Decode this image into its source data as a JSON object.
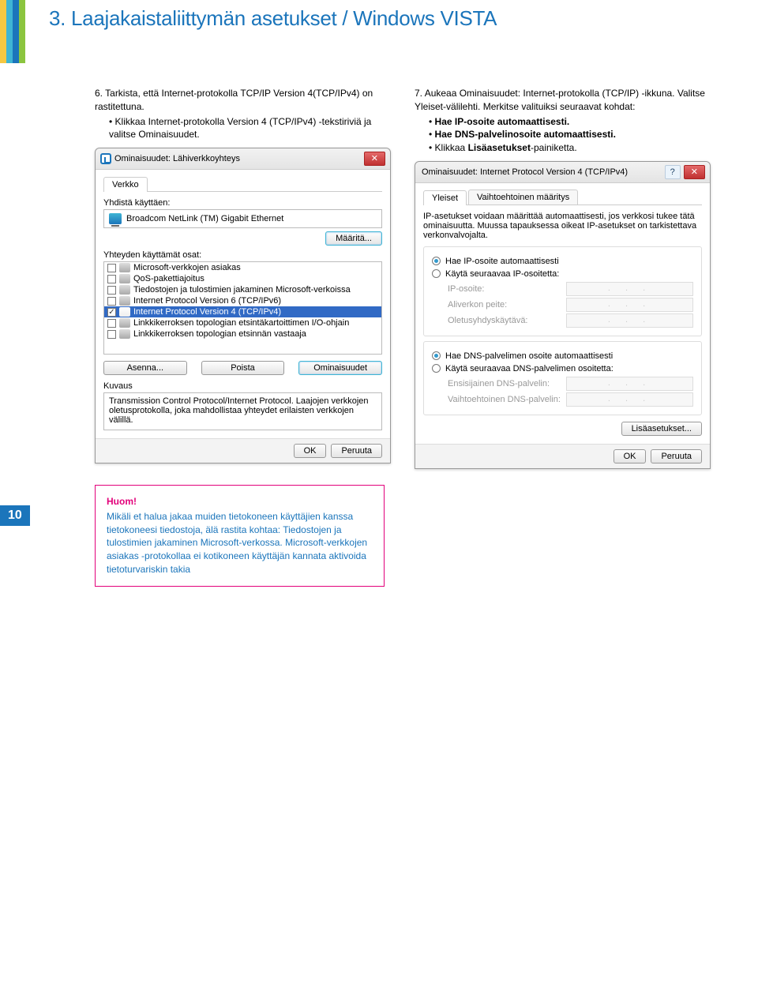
{
  "header": {
    "section_title": "3. Laajakaistaliittymän asetukset / Windows VISTA"
  },
  "instr6": {
    "num": "6.",
    "line1": "Tarkista, että Internet-protokolla TCP/IP Version 4(TCP/IPv4) on rastitettuna.",
    "bullet1": "Klikkaa Internet-protokolla Version 4 (TCP/IPv4) -tekstiriviä ja valitse Ominaisuudet."
  },
  "instr7": {
    "num": "7.",
    "line1": "Aukeaa Ominaisuudet: Internet-protokolla (TCP/IP) -ikkuna. Valitse Yleiset-välilehti. Merkitse valituiksi seuraavat kohdat:",
    "bullet1": "Hae IP-osoite automaattisesti.",
    "bullet2": "Hae DNS-palvelinosoite automaattisesti.",
    "bullet3": "Klikkaa Lisäasetukset-painiketta."
  },
  "dialog1": {
    "title": "Ominaisuudet: Lähiverkkoyhteys",
    "tab_verkko": "Verkko",
    "label_yhdista": "Yhdistä käyttäen:",
    "adapter": "Broadcom NetLink (TM) Gigabit Ethernet",
    "btn_maarita": "Määritä...",
    "label_osat": "Yhteyden käyttämät osat:",
    "items": [
      {
        "checked": false,
        "text": "Microsoft-verkkojen asiakas"
      },
      {
        "checked": false,
        "text": "QoS-pakettiajoitus"
      },
      {
        "checked": false,
        "text": "Tiedostojen ja tulostimien jakaminen Microsoft-verkoissa"
      },
      {
        "checked": false,
        "text": "Internet Protocol Version 6 (TCP/IPv6)"
      },
      {
        "checked": true,
        "highlight": true,
        "text": "Internet Protocol Version 4 (TCP/IPv4)"
      },
      {
        "checked": false,
        "text": "Linkkikerroksen topologian etsintäkartoittimen I/O-ohjain"
      },
      {
        "checked": false,
        "text": "Linkkikerroksen topologian etsinnän vastaaja"
      }
    ],
    "btn_asenna": "Asenna...",
    "btn_poista": "Poista",
    "btn_ominaisuudet": "Ominaisuudet",
    "label_kuvaus": "Kuvaus",
    "kuvaus_text": "Transmission Control Protocol/Internet Protocol. Laajojen verkkojen oletusprotokolla, joka mahdollistaa yhteydet erilaisten verkkojen välillä.",
    "btn_ok": "OK",
    "btn_peruuta": "Peruuta"
  },
  "dialog2": {
    "title": "Ominaisuudet: Internet Protocol Version 4 (TCP/IPv4)",
    "tab_yleiset": "Yleiset",
    "tab_vaihto": "Vaihtoehtoinen määritys",
    "info": "IP-asetukset voidaan määrittää automaattisesti, jos verkkosi tukee tätä ominaisuutta. Muussa tapauksessa oikeat IP-asetukset on tarkistettava verkonvalvojalta.",
    "radio_hae_ip": "Hae IP-osoite automaattisesti",
    "radio_kayta_ip": "Käytä seuraavaa IP-osoitetta:",
    "lbl_iposoite": "IP-osoite:",
    "lbl_aliverkko": "Aliverkon peite:",
    "lbl_oletus": "Oletusyhdyskäytävä:",
    "radio_hae_dns": "Hae DNS-palvelimen osoite automaattisesti",
    "radio_kayta_dns": "Käytä seuraavaa DNS-palvelimen osoitetta:",
    "lbl_ensi_dns": "Ensisijainen DNS-palvelin:",
    "lbl_vaihto_dns": "Vaihtoehtoinen DNS-palvelin:",
    "btn_lisaasetukset": "Lisäasetukset...",
    "btn_ok": "OK",
    "btn_peruuta": "Peruuta"
  },
  "page_number": "10",
  "huom": {
    "title": "Huom!",
    "text": "Mikäli et halua jakaa muiden tietokoneen käyttäjien kanssa tietokoneesi tiedostoja, älä rastita kohtaa: Tiedostojen ja tulostimien jakaminen Microsoft-verkossa. Microsoft-verkkojen asiakas -protokollaa ei kotikoneen käyttäjän kannata aktivoida tietoturvariskin takia"
  }
}
